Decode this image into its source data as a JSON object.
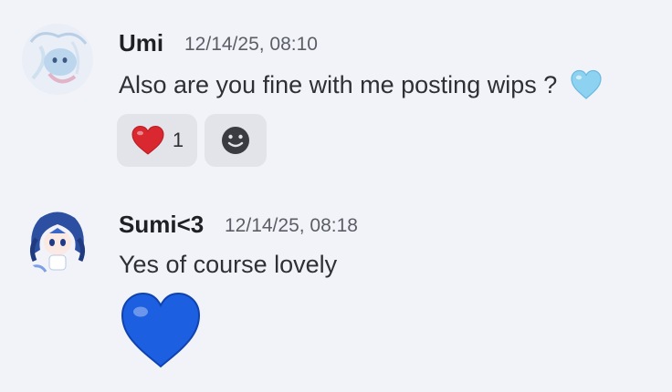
{
  "messages": [
    {
      "author": "Umi",
      "timestamp": "12/14/25, 08:10",
      "text": "Also are you fine with me posting wips ?",
      "inline_emoji": "light-blue-heart-emoji",
      "reactions": [
        {
          "emoji": "red-heart-emoji",
          "count": "1"
        }
      ],
      "add_reaction_icon": "smiley-add-reaction-icon"
    },
    {
      "author": "Sumi<3",
      "timestamp": "12/14/25, 08:18",
      "text": "Yes of course lovely",
      "jumbo_emoji": "blue-heart-emoji"
    }
  ],
  "colors": {
    "background": "#f2f3f8",
    "reaction_bg": "#e2e4ea",
    "author": "#1f2023",
    "timestamp": "#5b5e66",
    "text": "#2e3035",
    "blue_heart": "#1c5fe0",
    "light_blue_heart": "#8ed2f2",
    "red_heart": "#d9282f"
  }
}
